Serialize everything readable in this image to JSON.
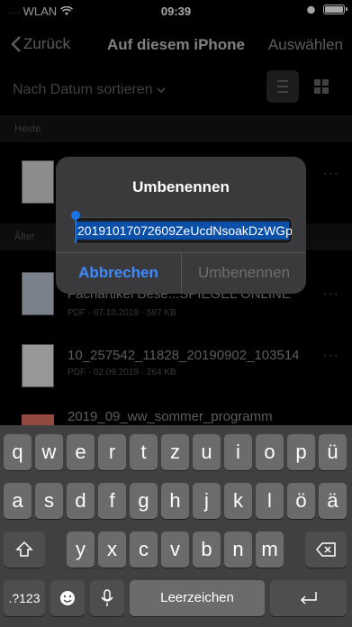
{
  "status_bar": {
    "carrier": "WLAN",
    "time": "09:39"
  },
  "nav": {
    "back_label": "Zurück",
    "title": "Auf diesem iPhone",
    "select_label": "Auswählen"
  },
  "sort": {
    "label": "Nach Datum sortieren"
  },
  "sections": {
    "today": "Heute",
    "older": "Älter"
  },
  "files": [
    {
      "name": "Fachartikel Bese...SPIEGEL ONLINE",
      "meta": "PDF · 07.10.2019 · 587 KB"
    },
    {
      "name": "10_257542_11828_20190902_103514",
      "meta": "PDF · 02.09.2019 · 264 KB"
    },
    {
      "name": "2019_09_ww_sommer_programm",
      "meta": ""
    }
  ],
  "dialog": {
    "title": "Umbenennen",
    "input_value": "20191017072609ZeUcdNsoakDzWGp",
    "cancel_label": "Abbrechen",
    "confirm_label": "Umbenennen"
  },
  "keyboard": {
    "row1": [
      "q",
      "w",
      "e",
      "r",
      "t",
      "z",
      "u",
      "i",
      "o",
      "p",
      "ü"
    ],
    "row2": [
      "a",
      "s",
      "d",
      "f",
      "g",
      "h",
      "j",
      "k",
      "l",
      "ö",
      "ä"
    ],
    "row3": [
      "y",
      "x",
      "c",
      "v",
      "b",
      "n",
      "m"
    ],
    "numbers_key": ".?123",
    "space_label": "Leerzeichen"
  }
}
